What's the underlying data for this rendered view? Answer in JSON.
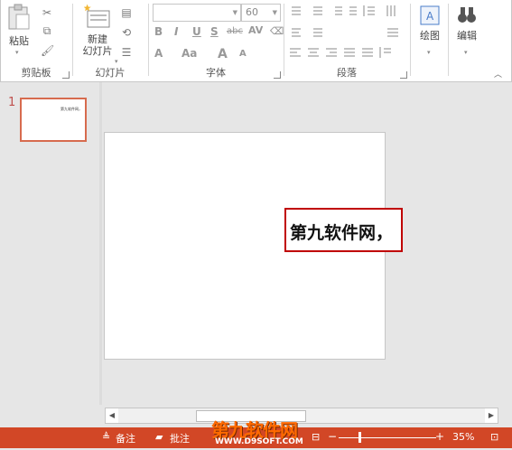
{
  "ribbon": {
    "clipboard": {
      "paste_label": "粘贴",
      "group_label": "剪贴板"
    },
    "slides": {
      "new_slide_label_line1": "新建",
      "new_slide_label_line2": "幻灯片",
      "group_label": "幻灯片"
    },
    "font": {
      "font_name": "",
      "font_size": "60",
      "group_label": "字体",
      "format_buttons": [
        "B",
        "I",
        "U",
        "S",
        "abc",
        "AV"
      ],
      "row3": [
        "A",
        "Aa",
        "A",
        "A"
      ]
    },
    "paragraph": {
      "group_label": "段落"
    },
    "drawing": {
      "label": "绘图"
    },
    "editing": {
      "label": "编辑"
    }
  },
  "thumbnails": {
    "slide_number": "1",
    "thumb_text": "第九软件网，"
  },
  "slide": {
    "textbox_text": "第九软件网，"
  },
  "statusbar": {
    "notes_label": "备注",
    "comments_label": "批注",
    "zoom_percent": "35%",
    "zoom_level": 0.35,
    "watermark_line1": "第九软件网",
    "watermark_line2": "WWW.D9SOFT.COM"
  },
  "colors": {
    "status_bar": "#d24726",
    "selection_border": "#c00000",
    "thumb_border": "#d76b4e"
  }
}
